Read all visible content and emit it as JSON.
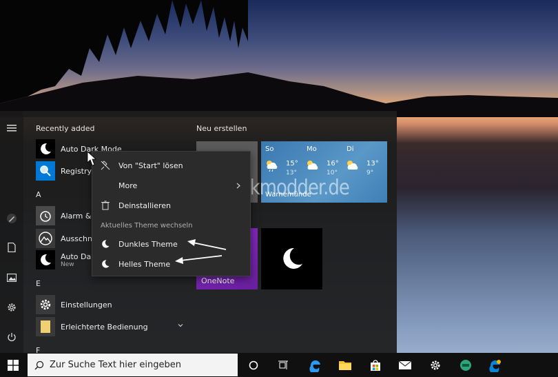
{
  "start_menu": {
    "recently_added_label": "Recently added",
    "apps": [
      {
        "label": "Auto Dark Mode"
      },
      {
        "label": "Registry F"
      },
      {
        "label": "Alarm & U"
      },
      {
        "label": "Ausschne"
      },
      {
        "label": "Auto Dar",
        "sub": "New"
      },
      {
        "label": "Einstellungen"
      },
      {
        "label": "Erleichterte Bedienung"
      }
    ],
    "letters": [
      "A",
      "E",
      "F"
    ]
  },
  "tiles": {
    "group_title": "Neu erstellen",
    "weather": {
      "days": [
        {
          "day": "So",
          "hi": "15°",
          "lo": "13°"
        },
        {
          "day": "Mo",
          "hi": "16°",
          "lo": "10°"
        },
        {
          "day": "Di",
          "hi": "13°",
          "lo": "9°"
        }
      ],
      "city": "Warnemünde"
    },
    "onenote_label": "OneNote"
  },
  "context_menu": {
    "unpin": "Von \"Start\" lösen",
    "more": "More",
    "uninstall": "Deinstallieren",
    "section_header": "Aktuelles Theme wechseln",
    "dark_theme": "Dunkles Theme",
    "light_theme": "Helles Theme"
  },
  "watermark": "Deskmodder.de",
  "taskbar": {
    "search_placeholder": "Zur Suche Text hier eingeben"
  },
  "colors": {
    "accent": "#0078d7",
    "onenote": "#7b2bb5",
    "weather": "#4a88c0"
  }
}
